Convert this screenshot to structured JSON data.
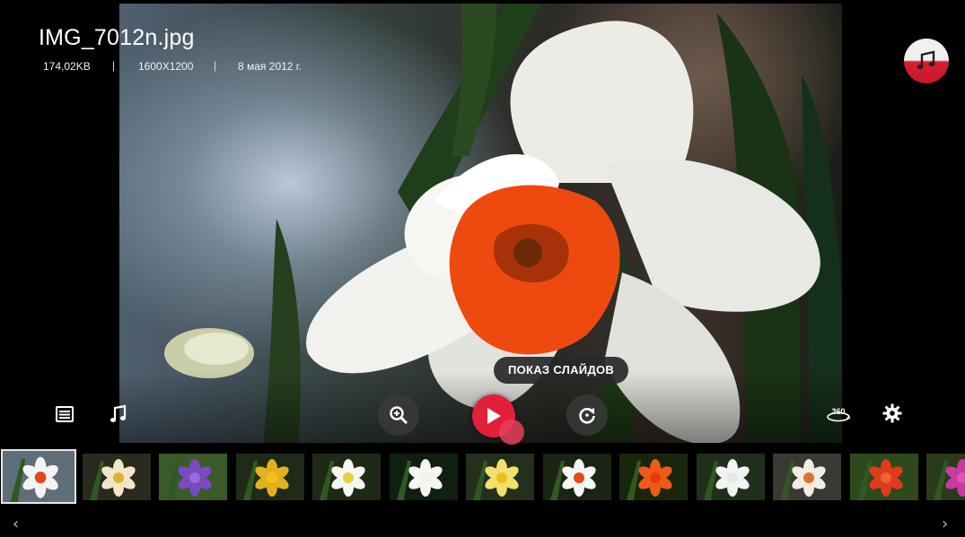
{
  "file": {
    "name": "IMG_7012n.jpg",
    "size": "174,02KB",
    "resolution": "1600X1200",
    "date": "8 мая 2012 г.",
    "separator": "|"
  },
  "controls": {
    "playlist_icon": "list-icon",
    "music_icon": "music-note-icon",
    "zoom_icon": "zoom-in-icon",
    "play_icon": "play-icon",
    "rotate_icon": "rotate-icon",
    "view360_label": "360",
    "settings_icon": "gear-icon",
    "tooltip": "ПОКАЗ СЛАЙДОВ"
  },
  "thumbnails": [
    {
      "name": "white-narcissus",
      "bg": "#5f6f7a",
      "petal": "#f4f4f4",
      "center": "#e24a1a",
      "selected": true
    },
    {
      "name": "yellow-daffodils",
      "bg": "#2a2a1e",
      "petal": "#f1e7c8",
      "center": "#d9b530",
      "selected": false
    },
    {
      "name": "purple-crocus",
      "bg": "#3a5a2a",
      "petal": "#7a4ac0",
      "center": "#9a6ad8",
      "selected": false
    },
    {
      "name": "yellow-daffodil",
      "bg": "#1f2a18",
      "petal": "#e2b21c",
      "center": "#f0c020",
      "selected": false
    },
    {
      "name": "white-narcissus-cluster",
      "bg": "#1e2a16",
      "petal": "#f6f6f2",
      "center": "#e8d040",
      "selected": false
    },
    {
      "name": "white-daffodil",
      "bg": "#102010",
      "petal": "#f5f5f5",
      "center": "#f2f2e6",
      "selected": false
    },
    {
      "name": "yellow-double-daffodil",
      "bg": "#24301c",
      "petal": "#f3e06a",
      "center": "#e8c020",
      "selected": false
    },
    {
      "name": "white-red-narcissus",
      "bg": "#1a2414",
      "petal": "#f7f7f7",
      "center": "#e8481c",
      "selected": false
    },
    {
      "name": "orange-lily",
      "bg": "#18260e",
      "petal": "#f05a18",
      "center": "#e83a10",
      "selected": false
    },
    {
      "name": "white-star-flower",
      "bg": "#20301a",
      "petal": "#f2f4f4",
      "center": "#e4e8e0",
      "selected": false
    },
    {
      "name": "white-orange-narcissus",
      "bg": "#3a3a34",
      "petal": "#f2ece4",
      "center": "#e07030",
      "selected": false
    },
    {
      "name": "red-tulips",
      "bg": "#2e4a1c",
      "petal": "#e03a1c",
      "center": "#f06030",
      "selected": false
    },
    {
      "name": "magenta-flowers",
      "bg": "#2a3a1a",
      "petal": "#c83aa0",
      "center": "#e050b8",
      "selected": false
    }
  ],
  "nav": {
    "prev": "‹",
    "next": "›"
  }
}
